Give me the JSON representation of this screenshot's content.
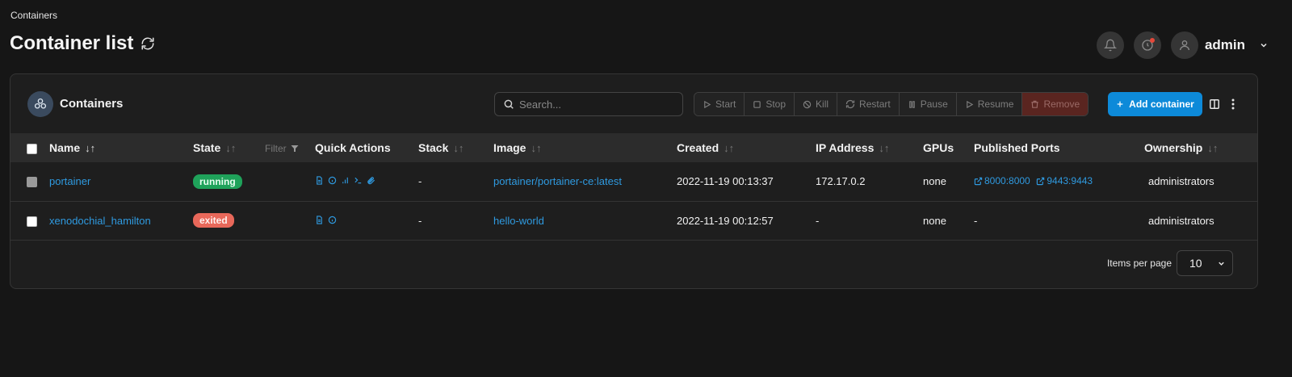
{
  "breadcrumb": "Containers",
  "page_title": "Container list",
  "user": {
    "name": "admin"
  },
  "panel": {
    "title": "Containers",
    "search_placeholder": "Search...",
    "actions": [
      "Start",
      "Stop",
      "Kill",
      "Restart",
      "Pause",
      "Resume",
      "Remove"
    ],
    "add_label": "Add container"
  },
  "columns": {
    "name": "Name",
    "state": "State",
    "filter": "Filter",
    "quick_actions": "Quick Actions",
    "stack": "Stack",
    "image": "Image",
    "created": "Created",
    "ip": "IP Address",
    "gpus": "GPUs",
    "ports": "Published Ports",
    "ownership": "Ownership"
  },
  "rows": [
    {
      "name": "portainer",
      "state": "running",
      "stack": "-",
      "image": "portainer/portainer-ce:latest",
      "created": "2022-11-19 00:13:37",
      "ip": "172.17.0.2",
      "gpus": "none",
      "ports": [
        "8000:8000",
        "9443:9443"
      ],
      "ownership": "administrators"
    },
    {
      "name": "xenodochial_hamilton",
      "state": "exited",
      "stack": "-",
      "image": "hello-world",
      "created": "2022-11-19 00:12:57",
      "ip": "-",
      "gpus": "none",
      "ports_text": "-",
      "ownership": "administrators"
    }
  ],
  "pagination": {
    "label": "Items per page",
    "value": "10"
  },
  "colors": {
    "accent": "#0d8ad9",
    "running": "#1fa25a",
    "exited": "#e8685a",
    "link": "#2f9ae0"
  }
}
